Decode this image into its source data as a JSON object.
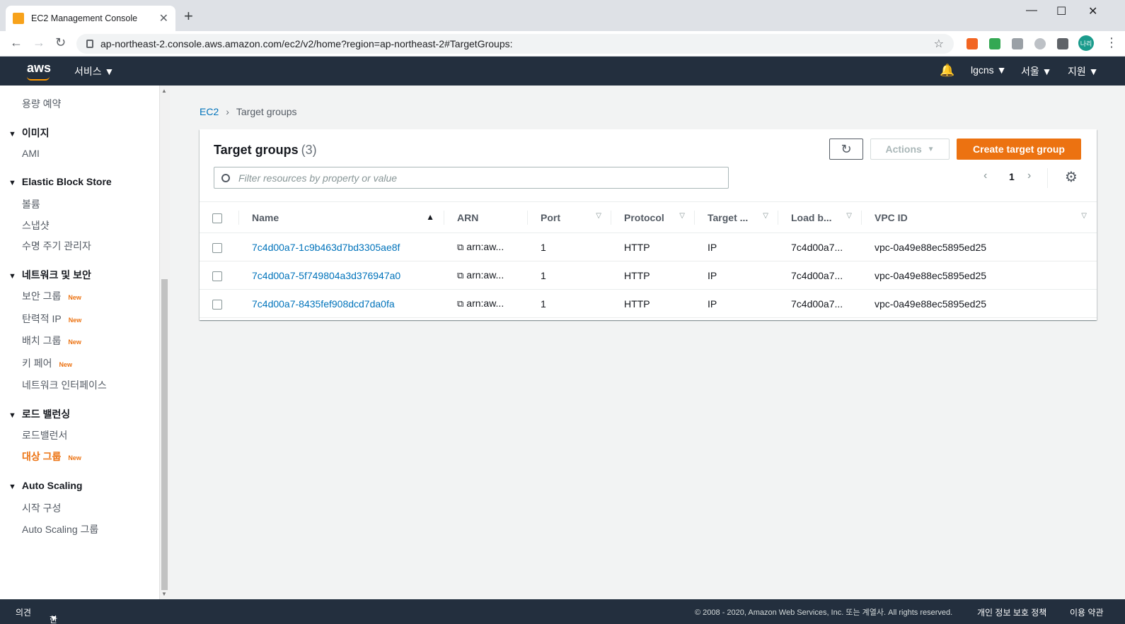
{
  "browser": {
    "tab_title": "EC2 Management Console",
    "url": "ap-northeast-2.console.aws.amazon.com/ec2/v2/home?region=ap-northeast-2#TargetGroups:",
    "profile_label": "나리"
  },
  "header": {
    "logo": "aws",
    "services_label": "서비스",
    "account_label": "lgcns",
    "region_label": "서울",
    "support_label": "지원"
  },
  "sidebar": {
    "item_reserved": "용량 예약",
    "sec_images": "이미지",
    "item_ami": "AMI",
    "sec_ebs": "Elastic Block Store",
    "item_volumes": "볼륨",
    "item_snapshots": "스냅샷",
    "item_lifecycle": "수명 주기 관리자",
    "sec_network": "네트워크 및 보안",
    "item_security_groups": "보안 그룹",
    "item_elastic_ip": "탄력적 IP",
    "item_placement_groups": "배치 그룹",
    "item_key_pairs": "키 페어",
    "item_network_interfaces": "네트워크 인터페이스",
    "sec_load_balancing": "로드 밸런싱",
    "item_load_balancers": "로드밸런서",
    "item_target_groups": "대상 그룹",
    "sec_auto_scaling": "Auto Scaling",
    "item_launch_config": "시작 구성",
    "item_asg": "Auto Scaling 그룹",
    "new_badge": "New"
  },
  "breadcrumb": {
    "root": "EC2",
    "current": "Target groups"
  },
  "panel": {
    "title": "Target groups",
    "count": "(3)",
    "actions_label": "Actions",
    "create_label": "Create target group",
    "filter_placeholder": "Filter resources by property or value",
    "page_number": "1"
  },
  "table": {
    "columns": [
      "Name",
      "ARN",
      "Port",
      "Protocol",
      "Target ...",
      "Load b...",
      "VPC ID"
    ],
    "rows": [
      {
        "name": "7c4d00a7-1c9b463d7bd3305ae8f",
        "arn": "arn:aw...",
        "port": "1",
        "protocol": "HTTP",
        "target": "IP",
        "lb": "7c4d00a7...",
        "vpc": "vpc-0a49e88ec5895ed25"
      },
      {
        "name": "7c4d00a7-5f749804a3d376947a0",
        "arn": "arn:aw...",
        "port": "1",
        "protocol": "HTTP",
        "target": "IP",
        "lb": "7c4d00a7...",
        "vpc": "vpc-0a49e88ec5895ed25"
      },
      {
        "name": "7c4d00a7-8435fef908dcd7da0fa",
        "arn": "arn:aw...",
        "port": "1",
        "protocol": "HTTP",
        "target": "IP",
        "lb": "7c4d00a7...",
        "vpc": "vpc-0a49e88ec5895ed25"
      }
    ]
  },
  "footer": {
    "feedback": "의견",
    "language": "한국어",
    "copyright": "© 2008 - 2020, Amazon Web Services, Inc. 또는 계열사. All rights reserved.",
    "privacy": "개인 정보 보호 정책",
    "terms": "이용 약관"
  },
  "colors": {
    "aws_header": "#232f3e",
    "accent_orange": "#ec7211",
    "link_blue": "#0073bb"
  },
  "icons": [
    "aws-favicon",
    "refresh-icon",
    "settings-gear-icon",
    "search-icon",
    "bell-icon",
    "copy-icon"
  ]
}
